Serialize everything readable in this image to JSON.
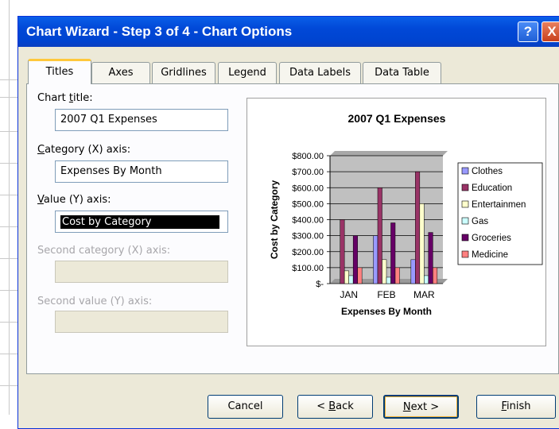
{
  "window": {
    "title": "Chart Wizard - Step 3 of 4 - Chart Options",
    "help_label": "?",
    "close_label": "X"
  },
  "tabs": [
    {
      "label": "Titles",
      "active": true
    },
    {
      "label": "Axes"
    },
    {
      "label": "Gridlines"
    },
    {
      "label": "Legend"
    },
    {
      "label": "Data Labels"
    },
    {
      "label": "Data Table"
    }
  ],
  "form": {
    "chart_title": {
      "label_pre": "Chart ",
      "label_u": "t",
      "label_post": "itle:",
      "value": "2007 Q1 Expenses"
    },
    "category_x": {
      "label_u": "C",
      "label_post": "ategory (X) axis:",
      "value": "Expenses By Month"
    },
    "value_y": {
      "label_u": "V",
      "label_post": "alue (Y) axis:",
      "value": "Cost by Category"
    },
    "second_category": {
      "label": "Second category (X) axis:",
      "value": ""
    },
    "second_value": {
      "label": "Second value (Y) axis:",
      "value": ""
    }
  },
  "buttons": {
    "cancel": "Cancel",
    "back_pre": "< ",
    "back_u": "B",
    "back_post": "ack",
    "next_u": "N",
    "next_post": "ext >",
    "finish_u": "F",
    "finish_post": "inish"
  },
  "chart_data": {
    "type": "bar",
    "title": "2007 Q1 Expenses",
    "xlabel": "Expenses By Month",
    "ylabel": "Cost by Category",
    "categories": [
      "JAN",
      "FEB",
      "MAR"
    ],
    "ylim": [
      0,
      800
    ],
    "yticks": [
      "$800.00",
      "$700.00",
      "$600.00",
      "$500.00",
      "$400.00",
      "$300.00",
      "$200.00",
      "$100.00",
      "$-"
    ],
    "grid": true,
    "legend": "right",
    "series": [
      {
        "name": "Clothes",
        "color": "#9999ff",
        "values": [
          0,
          300,
          150
        ]
      },
      {
        "name": "Education",
        "color": "#993366",
        "values": [
          400,
          600,
          700
        ]
      },
      {
        "name": "Entertainmen",
        "color": "#ffffcc",
        "values": [
          80,
          150,
          500
        ]
      },
      {
        "name": "Gas",
        "color": "#ccffff",
        "values": [
          50,
          40,
          50
        ]
      },
      {
        "name": "Groceries",
        "color": "#660066",
        "values": [
          300,
          380,
          320
        ]
      },
      {
        "name": "Medicine",
        "color": "#ff8080",
        "values": [
          100,
          100,
          100
        ]
      }
    ]
  }
}
